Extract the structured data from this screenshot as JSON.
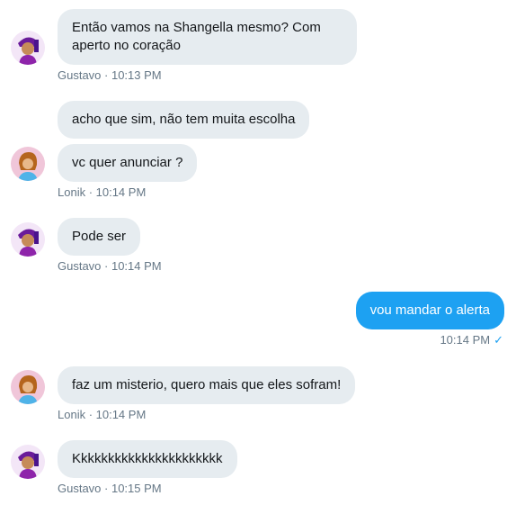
{
  "messages": [
    {
      "text": "Então vamos na Shangella mesmo? Com\naperto no coração",
      "meta": "Gustavo · 10:13 PM"
    },
    {
      "text": "acho que sim, não tem muita escolha"
    },
    {
      "text": "vc quer anunciar ?",
      "meta": "Lonik · 10:14 PM"
    },
    {
      "text": "Pode ser",
      "meta": "Gustavo · 10:14 PM"
    },
    {
      "text": "vou mandar o alerta",
      "meta": "10:14 PM",
      "status_icon": "✓"
    },
    {
      "text": "faz um misterio, quero mais que eles sofram!",
      "meta": "Lonik · 10:14 PM"
    },
    {
      "text": "Kkkkkkkkkkkkkkkkkkkkkk",
      "meta": "Gustavo · 10:15 PM"
    }
  ],
  "avatars": {
    "gustavo_icon": "purple-character-avatar-icon",
    "lonik_icon": "pink-character-avatar-icon"
  },
  "colors": {
    "incoming_bubble": "#e6ecf0",
    "outgoing_bubble": "#1da1f2",
    "meta_text": "#657786"
  }
}
